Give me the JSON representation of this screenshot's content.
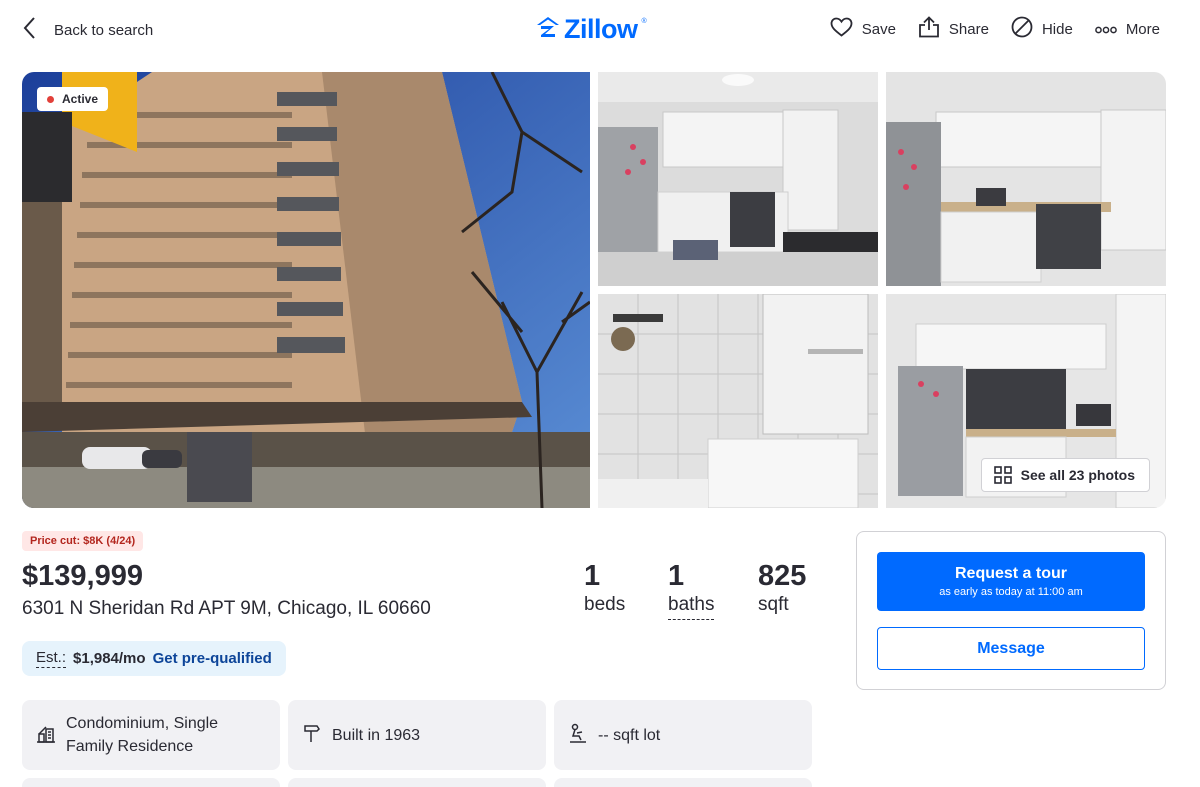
{
  "header": {
    "back_label": "Back to search",
    "logo_text": "Zillow",
    "actions": [
      {
        "label": "Save",
        "icon": "heart-icon"
      },
      {
        "label": "Share",
        "icon": "share-icon"
      },
      {
        "label": "Hide",
        "icon": "hide-icon"
      },
      {
        "label": "More",
        "icon": "more-icon"
      }
    ]
  },
  "gallery": {
    "status_badge": "Active",
    "see_all_label": "See all 23 photos"
  },
  "listing": {
    "price_cut": "Price cut: $8K (4/24)",
    "price": "$139,999",
    "address": "6301 N Sheridan Rd APT 9M, Chicago, IL 60660",
    "beds": {
      "value": "1",
      "label": "beds"
    },
    "baths": {
      "value": "1",
      "label": "baths"
    },
    "sqft": {
      "value": "825",
      "label": "sqft"
    },
    "estimate": {
      "label": "Est.:",
      "value": "$1,984/mo",
      "link": "Get pre-qualified"
    }
  },
  "facts_tiles": [
    {
      "icon": "building-icon",
      "line1": "Condominium, Single",
      "line2": "Family Residence"
    },
    {
      "icon": "hammer-icon",
      "line1": "Built in 1963",
      "line2": ""
    },
    {
      "icon": "lot-icon",
      "line1": "-- sqft lot",
      "line2": ""
    }
  ],
  "contact": {
    "tour_title": "Request a tour",
    "tour_sub": "as early as today at 11:00 am",
    "message_label": "Message"
  },
  "colors": {
    "brand": "#006aff",
    "text": "#2a2a33",
    "price_cut_bg": "#ffe7e6",
    "estimate_bg": "#e6f3fc"
  }
}
